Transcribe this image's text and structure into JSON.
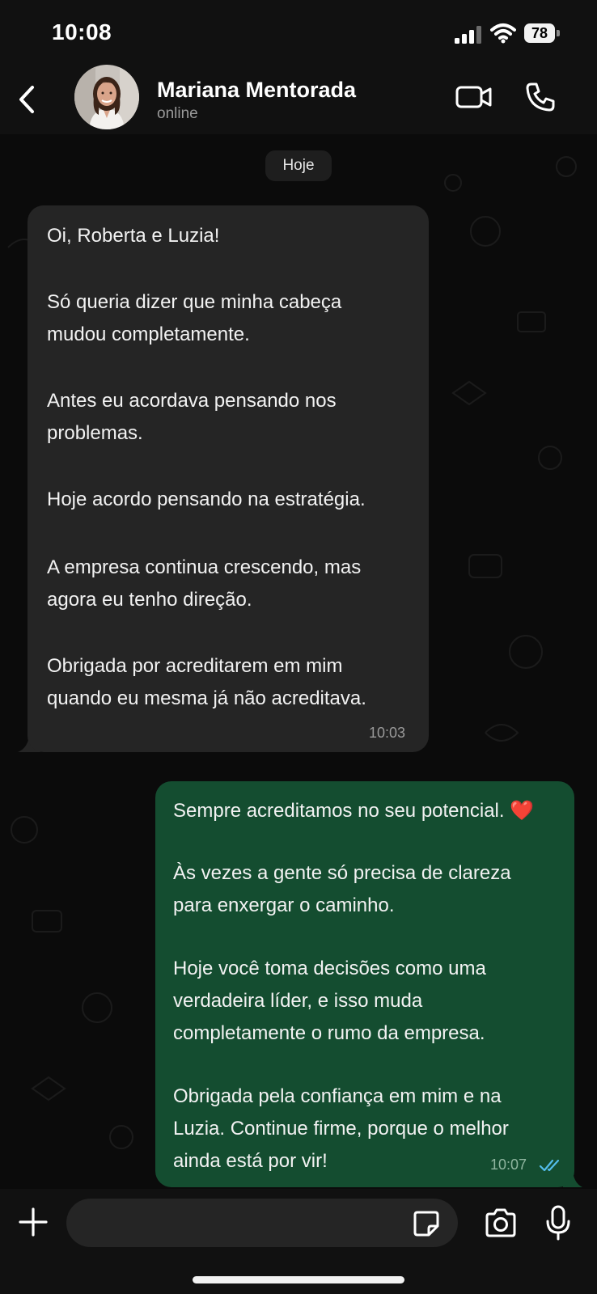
{
  "status_bar": {
    "time": "10:08",
    "battery_percent": "78",
    "signal_icon": "cellular-signal-icon",
    "wifi_icon": "wifi-icon"
  },
  "header": {
    "contact_name": "Mariana Mentorada",
    "contact_status": "online",
    "icons": {
      "back": "chevron-left-icon",
      "video": "video-camera-icon",
      "call": "phone-icon"
    }
  },
  "chat": {
    "date_label": "Hoje",
    "messages": [
      {
        "direction": "incoming",
        "lines": [
          "Oi, Roberta e Luzia!",
          "Só queria dizer que minha cabeça",
          "mudou completamente.",
          "Antes eu acordava pensando nos",
          "problemas.",
          "Hoje acordo pensando na estratégia.",
          "A empresa continua crescendo, mas",
          "agora eu tenho direção.",
          "Obrigada por acreditarem em mim",
          "quando eu mesma já não acreditava."
        ],
        "time": "10:03"
      },
      {
        "direction": "outgoing",
        "lines": [
          "Sempre acreditamos no seu potencial. ❤️",
          "Às vezes a gente só precisa de clareza",
          "para enxergar o caminho.",
          "Hoje você toma decisões como uma",
          "verdadeira líder, e isso muda",
          "completamente o rumo da empresa.",
          "Obrigada pela confiança em mim e na",
          "Luzia. Continue firme, porque o melhor",
          "ainda está por vir!"
        ],
        "time": "10:07",
        "read_status_icon": "double-check-read-icon"
      }
    ]
  },
  "input_bar": {
    "message_value": "",
    "icons": {
      "attach": "plus-icon",
      "sticker": "sticker-icon",
      "camera": "camera-icon",
      "mic": "microphone-icon"
    }
  },
  "colors": {
    "incoming_bubble": "#252525",
    "outgoing_bubble": "#144d30",
    "read_ticks": "#53bdeb",
    "background": "#0b0b0b"
  }
}
